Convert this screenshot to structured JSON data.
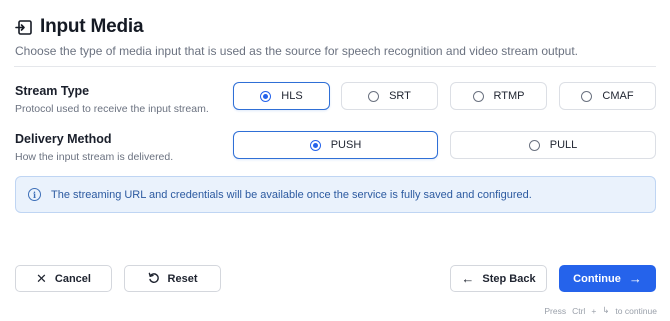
{
  "header": {
    "title": "Input Media",
    "subtitle": "Choose the type of media input that is used as the source for speech recognition and video stream output."
  },
  "stream_type": {
    "label": "Stream Type",
    "description": "Protocol used to receive the input stream.",
    "options": [
      "HLS",
      "SRT",
      "RTMP",
      "CMAF"
    ],
    "selected": "HLS"
  },
  "delivery_method": {
    "label": "Delivery Method",
    "description": "How the input stream is delivered.",
    "options": [
      "PUSH",
      "PULL"
    ],
    "selected": "PUSH"
  },
  "notice": {
    "text": "The streaming URL and credentials will be available once the service is fully saved and configured."
  },
  "footer": {
    "cancel_label": "Cancel",
    "reset_label": "Reset",
    "step_back_label": "Step Back",
    "continue_label": "Continue",
    "hint_press": "Press",
    "hint_key1": "Ctrl",
    "hint_plus": "+",
    "hint_key2": "↳",
    "hint_action": "to continue"
  },
  "colors": {
    "accent": "#2563eb",
    "notice_bg": "#eaf2fc",
    "notice_text": "#2c5aa0"
  },
  "icons": {
    "header": "input-media-icon",
    "notice": "info-icon",
    "cancel": "close-icon",
    "reset": "reset-icon",
    "step_back": "arrow-left-icon",
    "continue": "arrow-right-icon"
  }
}
